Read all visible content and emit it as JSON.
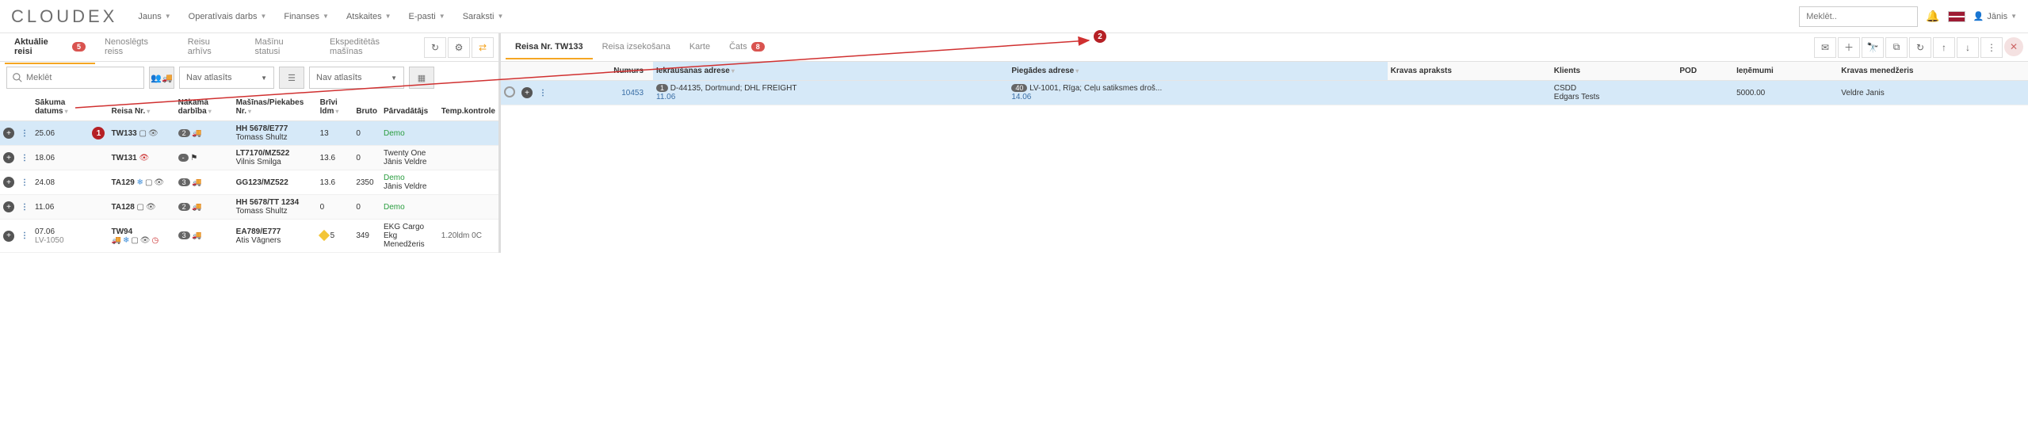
{
  "topbar": {
    "logo": "CLOUDEX",
    "menu": [
      "Jauns",
      "Operatīvais darbs",
      "Finanses",
      "Atskaites",
      "E-pasti",
      "Saraksti"
    ],
    "search_placeholder": "Meklēt..",
    "user": "Jānis"
  },
  "left": {
    "tabs": [
      {
        "label": "Aktuālie reisi",
        "badge": "5",
        "active": true
      },
      {
        "label": "Nenoslēgts reiss"
      },
      {
        "label": "Reisu arhīvs"
      },
      {
        "label": "Mašīnu statusi"
      },
      {
        "label": "Ekspeditētās mašīnas"
      }
    ],
    "filters": {
      "search_placeholder": "Meklēt",
      "drop1": "Nav atlasīts",
      "drop2": "Nav atlasīts"
    },
    "columns": {
      "date": "Sākuma datums",
      "reiss": "Reisa Nr.",
      "next": "Nākamā darbība",
      "vehicle": "Mašīnas/Piekabes Nr.",
      "free": "Brīvi ldm",
      "bruto": "Bruto",
      "carrier": "Pārvadātājs",
      "temp": "Temp.kontrole"
    },
    "rows": [
      {
        "date": "25.06",
        "reiss": "TW133",
        "reiss_icons": [
          "phone",
          "eye"
        ],
        "next_badge": "2",
        "next_icons": [
          "truck-red"
        ],
        "vehicle": "HH 5678/E777",
        "driver": "Tomass Shultz",
        "free": "13",
        "bruto": "0",
        "carrier": "Demo",
        "carrier_class": "demo-green",
        "temp": "",
        "hl": true,
        "marker": "1"
      },
      {
        "date": "18.06",
        "reiss": "TW131",
        "reiss_icons": [
          "eye-off-red"
        ],
        "next_badge": "-",
        "next_icons": [
          "flag"
        ],
        "vehicle": "LT7170/MZ522",
        "driver": "Vilnis Smilga",
        "free": "13.6",
        "bruto": "0",
        "carrier": "Twenty One",
        "carrier2": "Jānis Veldre",
        "temp": ""
      },
      {
        "date": "24.08",
        "reiss": "TA129",
        "reiss_icons": [
          "snow",
          "phone",
          "eye"
        ],
        "next_badge": "3",
        "next_icons": [
          "truck-orange"
        ],
        "vehicle": "GG123/MZ522",
        "driver": "",
        "free": "13.6",
        "bruto": "2350",
        "carrier": "Demo",
        "carrier_class": "demo-green",
        "carrier2": "Jānis Veldre",
        "temp": ""
      },
      {
        "date": "11.06",
        "reiss": "TA128",
        "reiss_icons": [
          "phone",
          "eye"
        ],
        "next_badge": "2",
        "next_icons": [
          "truck-red"
        ],
        "vehicle": "HH 5678/TT 1234",
        "driver": "Tomass Shultz",
        "free": "0",
        "bruto": "0",
        "carrier": "Demo",
        "carrier_class": "demo-green",
        "temp": ""
      },
      {
        "date": "07.06",
        "date2": "LV-1050",
        "reiss": "TW94",
        "reiss_icons": [
          "truck-red",
          "snow",
          "phone",
          "eye",
          "clock-red"
        ],
        "next_badge": "3",
        "next_icons": [
          "truck-blue"
        ],
        "vehicle": "EA789/E777",
        "driver": "Atis Vāgners",
        "free": "5",
        "bruto": "349",
        "free_warn": true,
        "carrier": "EKG Cargo",
        "carrier2": "Ekg Menedžeris",
        "temp": "1.20ldm 0C"
      }
    ]
  },
  "right": {
    "tabs": [
      {
        "label": "Reisa Nr. TW133",
        "active": true
      },
      {
        "label": "Reisa izsekošana"
      },
      {
        "label": "Karte"
      },
      {
        "label": "Čats",
        "badge": "8"
      }
    ],
    "columns": {
      "num": "Numurs",
      "load": "Iekraušanas adrese",
      "deliver": "Piegādes adrese",
      "desc": "Kravas apraksts",
      "client": "Klients",
      "pod": "POD",
      "income": "Ieņēmumi",
      "manager": "Kravas menedžeris"
    },
    "rows": [
      {
        "num": "10453",
        "load_badge": "1",
        "load": "D-44135, Dortmund; DHL FREIGHT",
        "load_date": "11.06",
        "deliver_badge": "40",
        "deliver": "LV-1001, Rīga; Ceļu satiksmes droš...",
        "deliver_date": "14.06",
        "desc": "",
        "client": "CSDD",
        "client2": "Edgars Tests",
        "pod": "",
        "income": "5000.00",
        "manager": "Veldre Janis"
      }
    ],
    "marker": "2"
  }
}
